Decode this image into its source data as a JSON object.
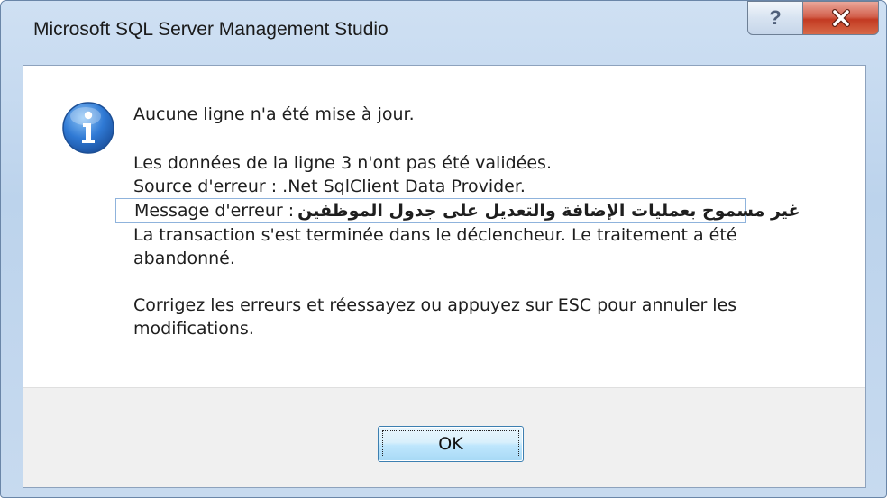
{
  "window": {
    "title": "Microsoft SQL Server Management Studio",
    "help_label": "?",
    "close_icon": "close-icon"
  },
  "message": {
    "icon": "info-icon",
    "line1": "Aucune ligne n'a été mise à jour.",
    "line2": "Les données de la ligne 3 n'ont pas été validées.",
    "line3": "Source d'erreur : .Net SqlClient Data Provider.",
    "line4_label": "Message d'erreur :",
    "line4_arabic": "غير مسموح بعمليات الإضافة والتعديل على جدول الموظفين",
    "line5": "La transaction s'est terminée dans le déclencheur. Le traitement a été abandonné.",
    "line6": "Corrigez les erreurs et réessayez ou appuyez sur ESC pour annuler les modifications."
  },
  "buttons": {
    "ok_label": "OK"
  }
}
